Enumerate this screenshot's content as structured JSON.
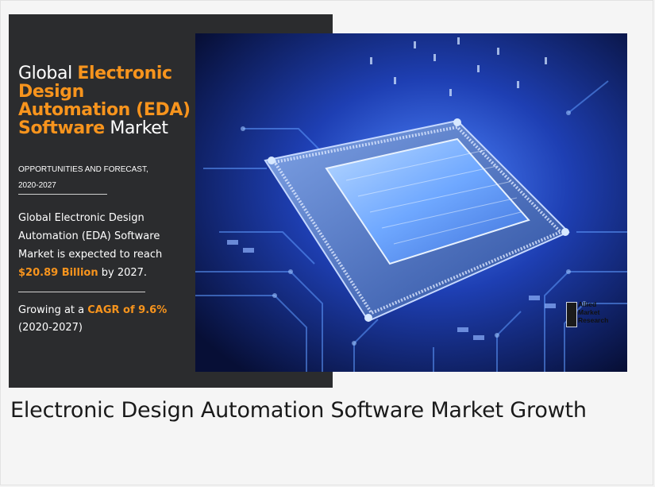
{
  "infographic": {
    "title_parts": [
      "Global ",
      "Electronic Design Automation (EDA) Software",
      " Market"
    ],
    "title_global": "Global",
    "title_hl_1": "Electronic",
    "title_hl_2": "Design",
    "title_hl_3": "Automation (EDA)",
    "title_hl_4": "Software",
    "title_market": "Market",
    "subtitle_line1": "OPPORTUNITIES AND FORECAST,",
    "subtitle_line2": "2020-2027",
    "stat_line1": "Global Electronic Design",
    "stat_line2": "Automation (EDA) Software",
    "stat_line3": "Market is expected to reach",
    "stat_value": "$20.89 Billion",
    "stat_suffix": " by 2027.",
    "cagr_prefix": "Growing at a ",
    "cagr_value": "CAGR of 9.6%",
    "cagr_period": "(2020-2027)",
    "logo_line1": "Allied",
    "logo_line2": "Market",
    "logo_line3": "Research"
  },
  "caption": {
    "text": "Electronic Design Automation Software Market Growth"
  },
  "colors": {
    "panel_bg": "#2b2c2e",
    "accent_orange": "#f7941d",
    "chip_bg": "#0b1a4d",
    "page_bg": "#f5f5f5"
  }
}
